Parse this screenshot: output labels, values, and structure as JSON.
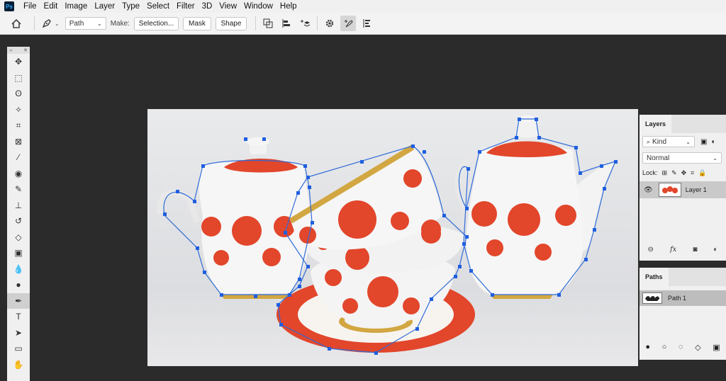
{
  "app": {
    "logo": "Ps"
  },
  "menu": [
    "File",
    "Edit",
    "Image",
    "Layer",
    "Type",
    "Select",
    "Filter",
    "3D",
    "View",
    "Window",
    "Help"
  ],
  "options": {
    "mode_value": "Path",
    "make_label": "Make:",
    "selection_label": "Selection...",
    "mask_label": "Mask",
    "shape_label": "Shape"
  },
  "toolbar": {
    "head": "››",
    "close": "✕",
    "tools": [
      {
        "name": "move-tool",
        "icon": "✥"
      },
      {
        "name": "marquee-tool",
        "icon": "⬚"
      },
      {
        "name": "lasso-tool",
        "icon": "ʘ"
      },
      {
        "name": "magic-wand-tool",
        "icon": "✧"
      },
      {
        "name": "crop-tool",
        "icon": "⌗"
      },
      {
        "name": "frame-tool",
        "icon": "⊠"
      },
      {
        "name": "eyedropper-tool",
        "icon": "⁄"
      },
      {
        "name": "healing-brush-tool",
        "icon": "◉"
      },
      {
        "name": "brush-tool",
        "icon": "✎"
      },
      {
        "name": "clone-stamp-tool",
        "icon": "⊥"
      },
      {
        "name": "history-brush-tool",
        "icon": "↺"
      },
      {
        "name": "eraser-tool",
        "icon": "◇"
      },
      {
        "name": "gradient-tool",
        "icon": "▣"
      },
      {
        "name": "blur-tool",
        "icon": "💧"
      },
      {
        "name": "dodge-tool",
        "icon": "●"
      },
      {
        "name": "pen-tool",
        "icon": "✒"
      },
      {
        "name": "type-tool",
        "icon": "T"
      },
      {
        "name": "path-selection-tool",
        "icon": "➤"
      },
      {
        "name": "rectangle-tool",
        "icon": "▭"
      },
      {
        "name": "hand-tool",
        "icon": "✋"
      }
    ]
  },
  "layers": {
    "tab": "Layers",
    "kind": "Kind",
    "blend": "Normal",
    "lock_label": "Lock:",
    "layer_name": "Layer 1",
    "footer_fx": "fx"
  },
  "paths": {
    "tab": "Paths",
    "path_name": "Path 1"
  },
  "colors": {
    "accent": "#2f6bd8",
    "anchor": "#1f5fe0",
    "dot": "#e2462b"
  }
}
